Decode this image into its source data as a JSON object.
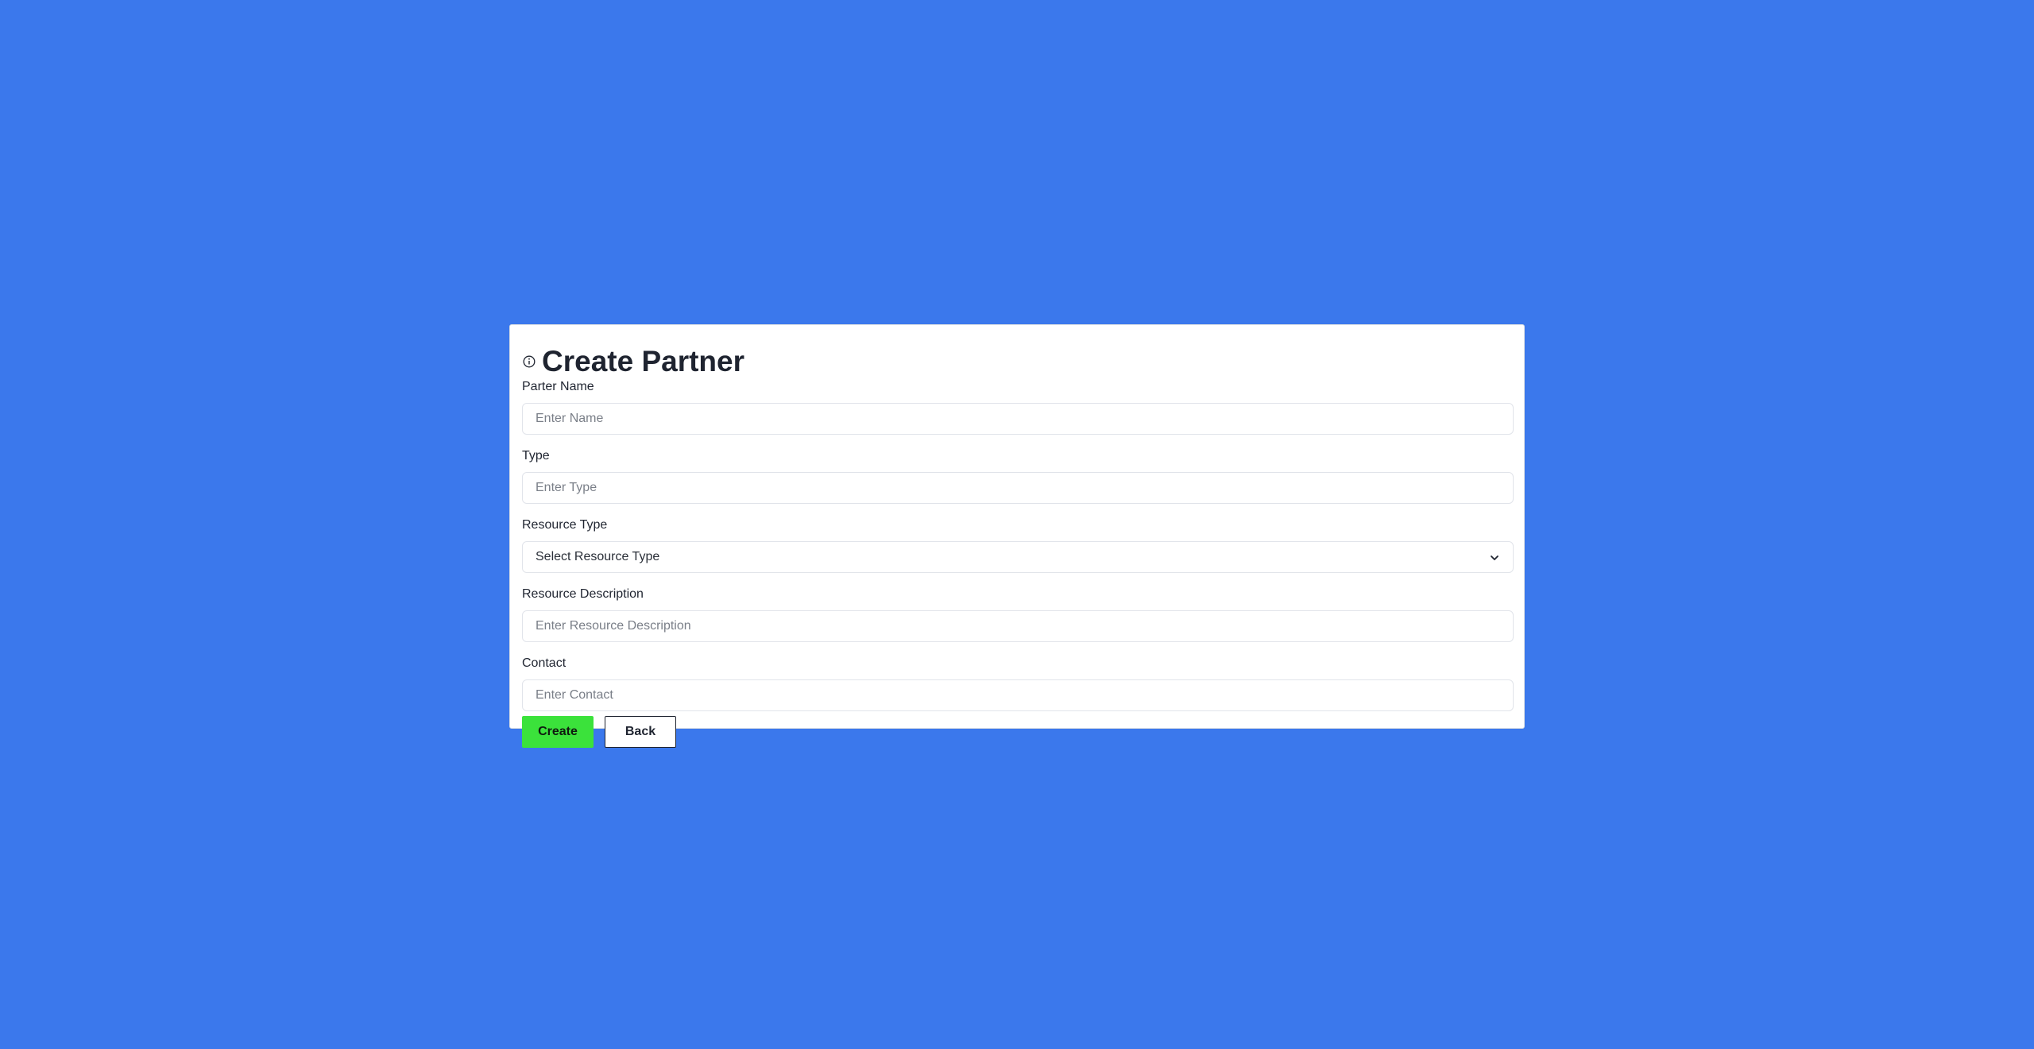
{
  "page": {
    "background_color": "#3b78ec"
  },
  "form": {
    "title": "Create Partner",
    "title_icon": "info-icon",
    "fields": [
      {
        "label": "Parter Name",
        "placeholder": "Enter Name",
        "value": ""
      },
      {
        "label": "Type",
        "placeholder": "Enter Type",
        "value": ""
      },
      {
        "label": "Resource Type",
        "selected": "Select Resource Type"
      },
      {
        "label": "Resource Description",
        "placeholder": "Enter Resource Description",
        "value": ""
      },
      {
        "label": "Contact",
        "placeholder": "Enter Contact",
        "value": ""
      }
    ],
    "create_label": "Create",
    "back_label": "Back",
    "create_color": "#3be23b"
  }
}
